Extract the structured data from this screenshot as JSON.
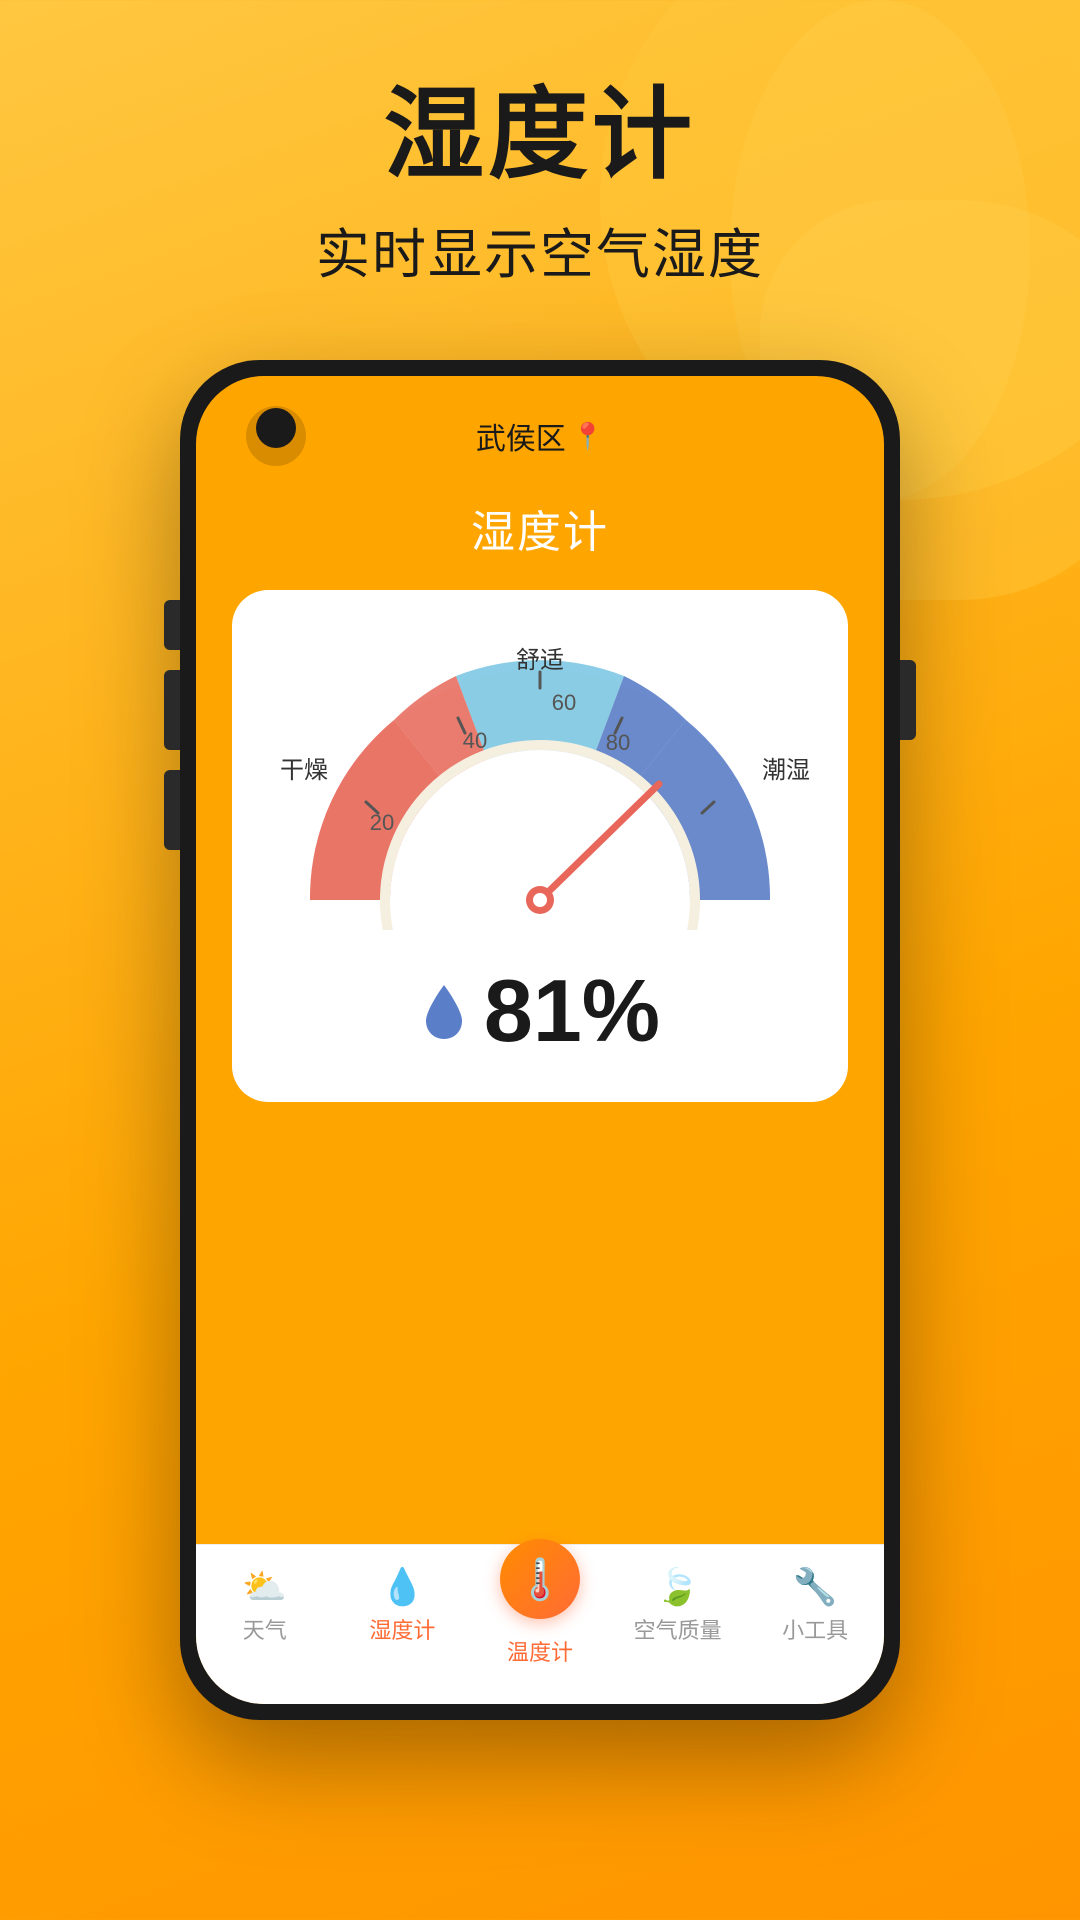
{
  "page": {
    "bg_color": "#FFA500",
    "main_title": "湿度计",
    "sub_title": "实时显示空气湿度"
  },
  "phone": {
    "location": "武侯区",
    "app_title": "湿度计",
    "plus_label": "+"
  },
  "gauge": {
    "label_dry": "干燥",
    "label_comfort": "舒适",
    "label_humid": "潮湿",
    "tick_20": "20",
    "tick_40": "40",
    "tick_60": "60",
    "tick_80": "80",
    "value": "81%",
    "needle_angle": 168
  },
  "bottom_nav": {
    "items": [
      {
        "label": "天气",
        "icon": "☁️",
        "active": false
      },
      {
        "label": "湿度计",
        "icon": "💧",
        "active": true
      },
      {
        "label": "温度计",
        "icon": "🌡️",
        "active": false,
        "is_center": true
      },
      {
        "label": "空气质量",
        "icon": "🍃",
        "active": false
      },
      {
        "label": "小工具",
        "icon": "🔧",
        "active": false
      }
    ]
  }
}
